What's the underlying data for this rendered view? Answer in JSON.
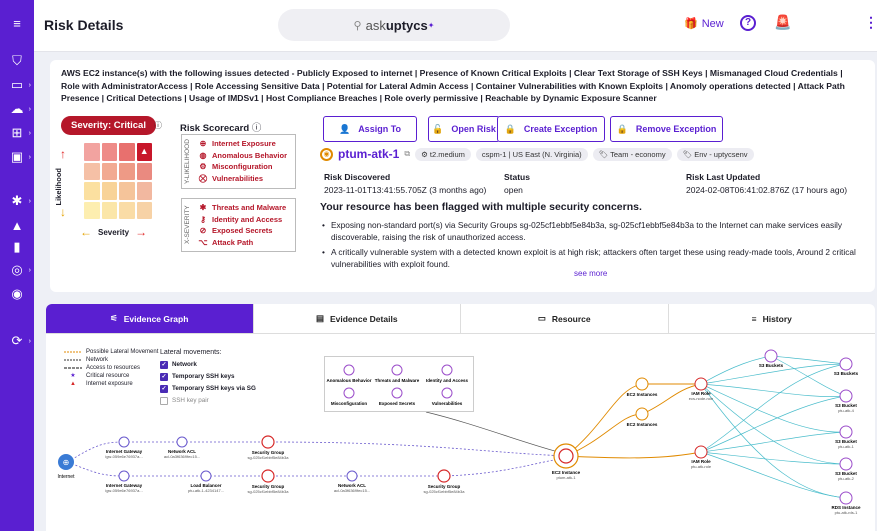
{
  "header": {
    "title": "Risk Details",
    "search_prefix": "ask ",
    "search_brand": "uptycs",
    "new_label": "New",
    "help_label": "?"
  },
  "sidebar": {
    "icons": [
      "menu-icon",
      "shield-icon",
      "monitor-icon",
      "cloud-icon",
      "grid-icon",
      "terminal-icon",
      "bug-icon",
      "bell-icon",
      "badge-icon",
      "target-icon",
      "location-icon",
      "sync-icon"
    ]
  },
  "description": "AWS EC2 instance(s) with the following issues detected - Publicly Exposed to internet | Presence of Known Critical Exploits | Clear Text Storage of SSH Keys | Mismanaged Cloud Credentials | Role with AdministratorAccess | Role Accessing Sensitive Data | Potential for Lateral Admin Access | Container Vulnerabilities with Known Exploits | Anomoly operations detected | Attack Path Presence | Critical Detections | Usage of IMDSv1 | Host Compliance Breaches | Role overly permissive | Reachable by Dynamic Exposure Scanner",
  "severity": {
    "label": "Severity: Critical",
    "likelihood": "Likelihood",
    "severity_axis": "Severity",
    "grid_colors": [
      [
        "#f2a3a0",
        "#ee8b88",
        "#e8706e",
        "#c8172a"
      ],
      [
        "#f5c0a6",
        "#f2aa92",
        "#ee9a86",
        "#ea8a80"
      ],
      [
        "#fbe0a0",
        "#f8d398",
        "#f5c49a",
        "#f2b8a0"
      ],
      [
        "#fdeeb0",
        "#fbe6a8",
        "#fadca6",
        "#f7d2a6"
      ]
    ]
  },
  "scorecard": {
    "title": "Risk Scorecard",
    "y_axis": "Y-LIKELIHOOD",
    "x_axis": "X-SEVERITY",
    "likelihood_items": [
      "Internet Exposure",
      "Anomalous Behavior",
      "Misconfiguration",
      "Vulnerabilities"
    ],
    "severity_items": [
      "Threats and Malware",
      "Identity and Access",
      "Exposed Secrets",
      "Attack Path"
    ]
  },
  "actions": {
    "assign": "Assign To",
    "open": "Open Risk",
    "exception": "Create Exception",
    "remove": "Remove Exception"
  },
  "asset": {
    "name": "ptum-atk-1",
    "instance_type": "t2.medium",
    "region": "cspm-1 | US East (N. Virginia)",
    "team": "Team - economy",
    "env": "Env - uptycsenv"
  },
  "meta": {
    "discovered_label": "Risk Discovered",
    "discovered": "2023-11-01T13:41:55.705Z (3 months ago)",
    "status_label": "Status",
    "status": "open",
    "updated_label": "Risk Last Updated",
    "updated": "2024-02-08T06:41:02.876Z (17 hours ago)"
  },
  "flag_title": "Your resource has been flagged with multiple security concerns.",
  "bullets": [
    "Exposing non-standard port(s) via Security Groups sg-025cf1ebbf5e84b3a, sg-025cf1ebbf5e84b3a to the Internet can make services easily discoverable, raising the risk of unauthorized access.",
    "A critically vulnerable system with a detected known exploit is at high risk; attackers often target these using ready-made tools, Around 2 critical vulnerabilities with exploit found."
  ],
  "see_more": "see more",
  "tabs": [
    "Evidence Graph",
    "Evidence Details",
    "Resource",
    "History"
  ],
  "legend": [
    "Possible Lateral Movement",
    "Network",
    "Access to resources",
    "Critical resource",
    "Internet exposure"
  ],
  "lateral": {
    "title": "Lateral movements:",
    "items": [
      "Network",
      "Temporary SSH keys",
      "Temporary SSH keys via SG",
      "SSH key pair"
    ]
  },
  "threats": [
    "Anomalous Behavior",
    "Threats and Malware",
    "Identity and Access",
    "Misconfiguration",
    "Exposed Secrets",
    "Vulnerabilities"
  ],
  "graph": {
    "internet": "Internet",
    "gw1": [
      "Internet Gateway",
      "igw-059e6e76937a..."
    ],
    "acl1": [
      "Network ACL",
      "acl-0a3f6369fec15..."
    ],
    "sg1": [
      "Security Group",
      "sg-025cf1ebbf5e84b3a"
    ],
    "gw2": [
      "Internet Gateway",
      "igw-059e6e76937a..."
    ],
    "lb": [
      "Load Balancer",
      "ptu-atk-1-4234147..."
    ],
    "sg2": [
      "Security Group",
      "sg-025cf1ebbf5e84b3a"
    ],
    "acl2": [
      "Network ACL",
      "acl-0a3f6369fec15..."
    ],
    "sg3": [
      "Security Group",
      "sg-025cf1ebbf5e84b3a"
    ],
    "ec2": [
      "EC2 Instance",
      "ptum-atk-1"
    ],
    "ec2a": "EC2 Instances",
    "ec2b": "EC2 Instances",
    "iam1": [
      "IAM Role",
      "ecs-node-role"
    ],
    "iam2": [
      "IAM Role",
      "ptu-atk-role"
    ],
    "s3a": "S3 Buckets",
    "s3b": "S3 Buckets",
    "s3c": [
      "S3 Bucket",
      "ptu-atk-4"
    ],
    "s3d": [
      "S3 Bucket",
      "ptu-atk-1"
    ],
    "s3e": [
      "S3 Bucket",
      "ptu-atk-2"
    ],
    "rds": [
      "RDS Instance",
      "ptu-atk-rds-1"
    ]
  }
}
